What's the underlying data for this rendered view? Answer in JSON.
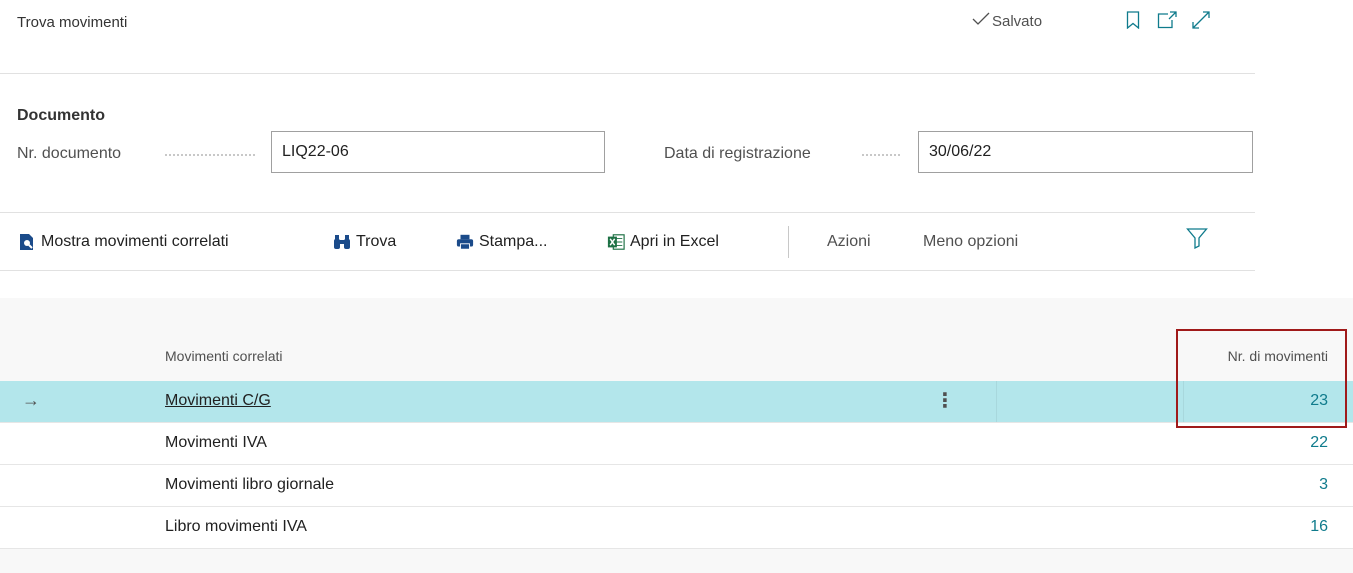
{
  "header": {
    "title": "Trova movimenti",
    "saved_label": "Salvato",
    "icons": [
      "check-icon",
      "bookmark-icon",
      "open-new-window-icon",
      "expand-icon"
    ]
  },
  "document": {
    "group_title": "Documento",
    "doc_no_label": "Nr. documento",
    "doc_no_value": "LIQ22-06",
    "posting_date_label": "Data di registrazione",
    "posting_date_value": "30/06/22"
  },
  "actions": {
    "show_related": "Mostra movimenti correlati",
    "find": "Trova",
    "print": "Stampa...",
    "open_excel": "Apri in Excel",
    "actions": "Azioni",
    "fewer_options": "Meno opzioni"
  },
  "table": {
    "columns": {
      "name": "Movimenti correlati",
      "count": "Nr. di movimenti"
    },
    "rows": [
      {
        "name": "Movimenti C/G",
        "count": "23",
        "selected": true
      },
      {
        "name": "Movimenti IVA",
        "count": "22"
      },
      {
        "name": "Movimenti libro giornale",
        "count": "3"
      },
      {
        "name": "Libro movimenti IVA",
        "count": "16"
      }
    ]
  },
  "colors": {
    "selected_row": "#b3e6eb",
    "count_text": "#0f7b8c",
    "highlight_border": "#a01a1a"
  }
}
